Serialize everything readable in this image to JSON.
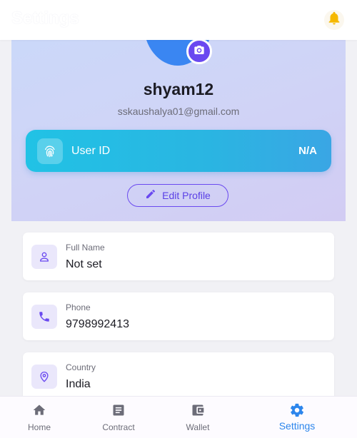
{
  "header": {
    "title": "Settings",
    "bell_icon": "bell-icon"
  },
  "profile": {
    "username": "shyam12",
    "email": "sskaushalya01@gmail.com",
    "user_id_label": "User ID",
    "user_id_value": "N/A",
    "edit_label": "Edit Profile"
  },
  "fields": [
    {
      "label": "Full Name",
      "value": "Not set",
      "icon": "person-icon"
    },
    {
      "label": "Phone",
      "value": "9798992413",
      "icon": "phone-icon"
    },
    {
      "label": "Country",
      "value": "India",
      "icon": "location-pin-icon"
    }
  ],
  "nav": [
    {
      "label": "Home",
      "icon": "home-icon"
    },
    {
      "label": "Contract",
      "icon": "contract-icon"
    },
    {
      "label": "Wallet",
      "icon": "wallet-icon"
    },
    {
      "label": "Settings",
      "icon": "gear-icon",
      "active": true
    }
  ],
  "colors": {
    "accent": "#6a49f0",
    "user_id_card": "#21c2e5",
    "active_nav": "#2d86ec",
    "bell": "#f5b800"
  }
}
